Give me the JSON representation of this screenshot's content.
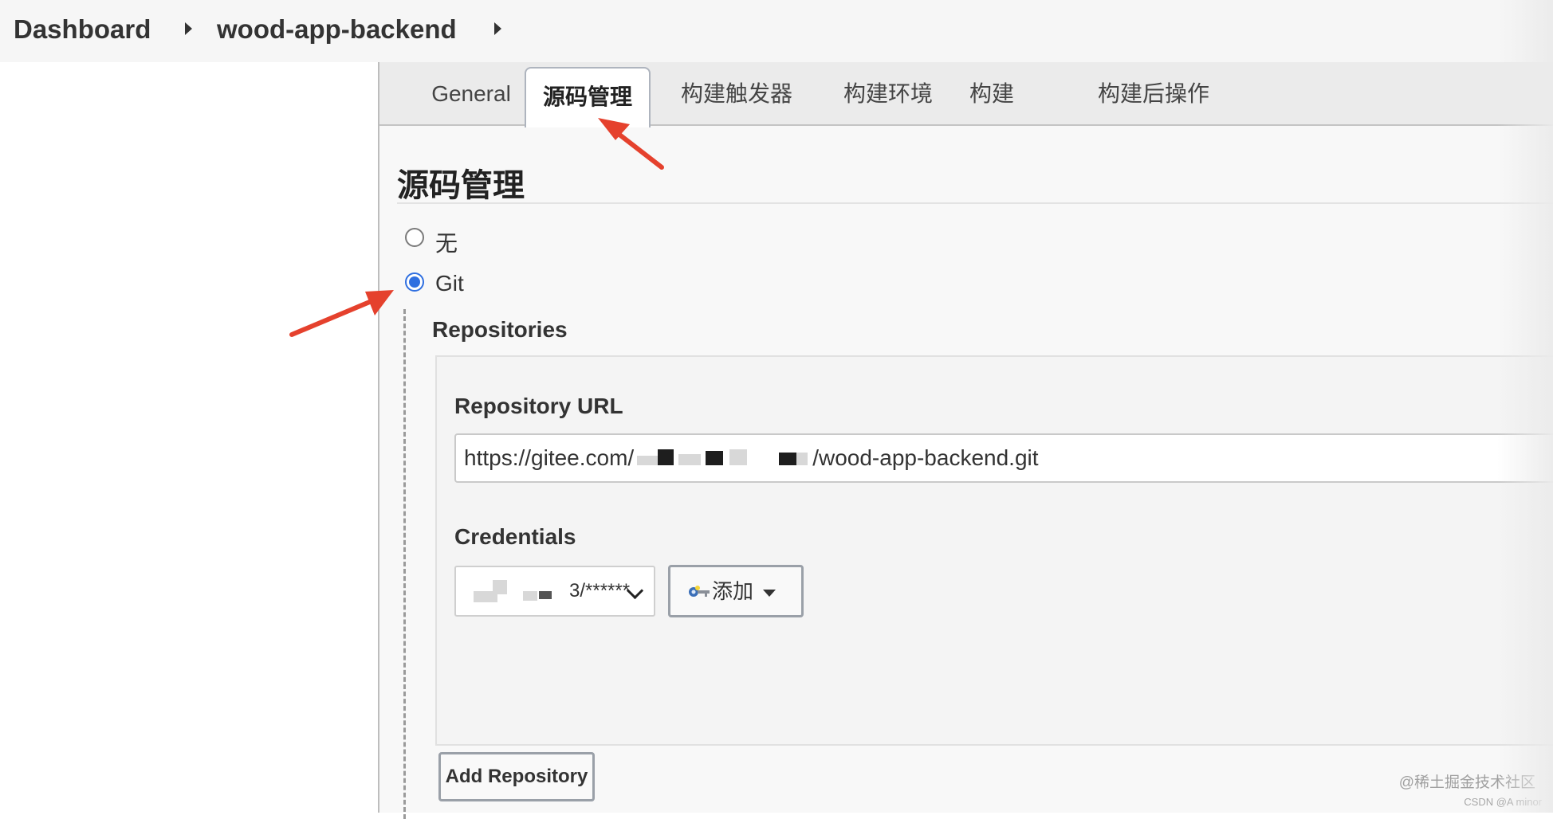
{
  "breadcrumb": {
    "items": [
      "Dashboard",
      "wood-app-backend"
    ]
  },
  "tabs": [
    {
      "label": "General",
      "active": false
    },
    {
      "label": "源码管理",
      "active": true
    },
    {
      "label": "构建触发器",
      "active": false
    },
    {
      "label": "构建环境",
      "active": false
    },
    {
      "label": "构建",
      "active": false
    },
    {
      "label": "构建后操作",
      "active": false
    }
  ],
  "scm": {
    "title": "源码管理",
    "options": [
      {
        "label": "无",
        "checked": false
      },
      {
        "label": "Git",
        "checked": true
      }
    ],
    "repositories_label": "Repositories",
    "repository_url_label": "Repository URL",
    "repository_url_prefix": "https://gitee.com/",
    "repository_url_suffix": "/wood-app-backend.git",
    "credentials_label": "Credentials",
    "credentials_value": "3/******",
    "add_button_label": "添加",
    "add_repository_label": "Add Repository"
  },
  "watermark": {
    "line1": "@稀土掘金技术社区",
    "line2": "CSDN @A minor"
  },
  "colors": {
    "accent_blue": "#2f6fe0",
    "annotation_red": "#e5412d"
  }
}
